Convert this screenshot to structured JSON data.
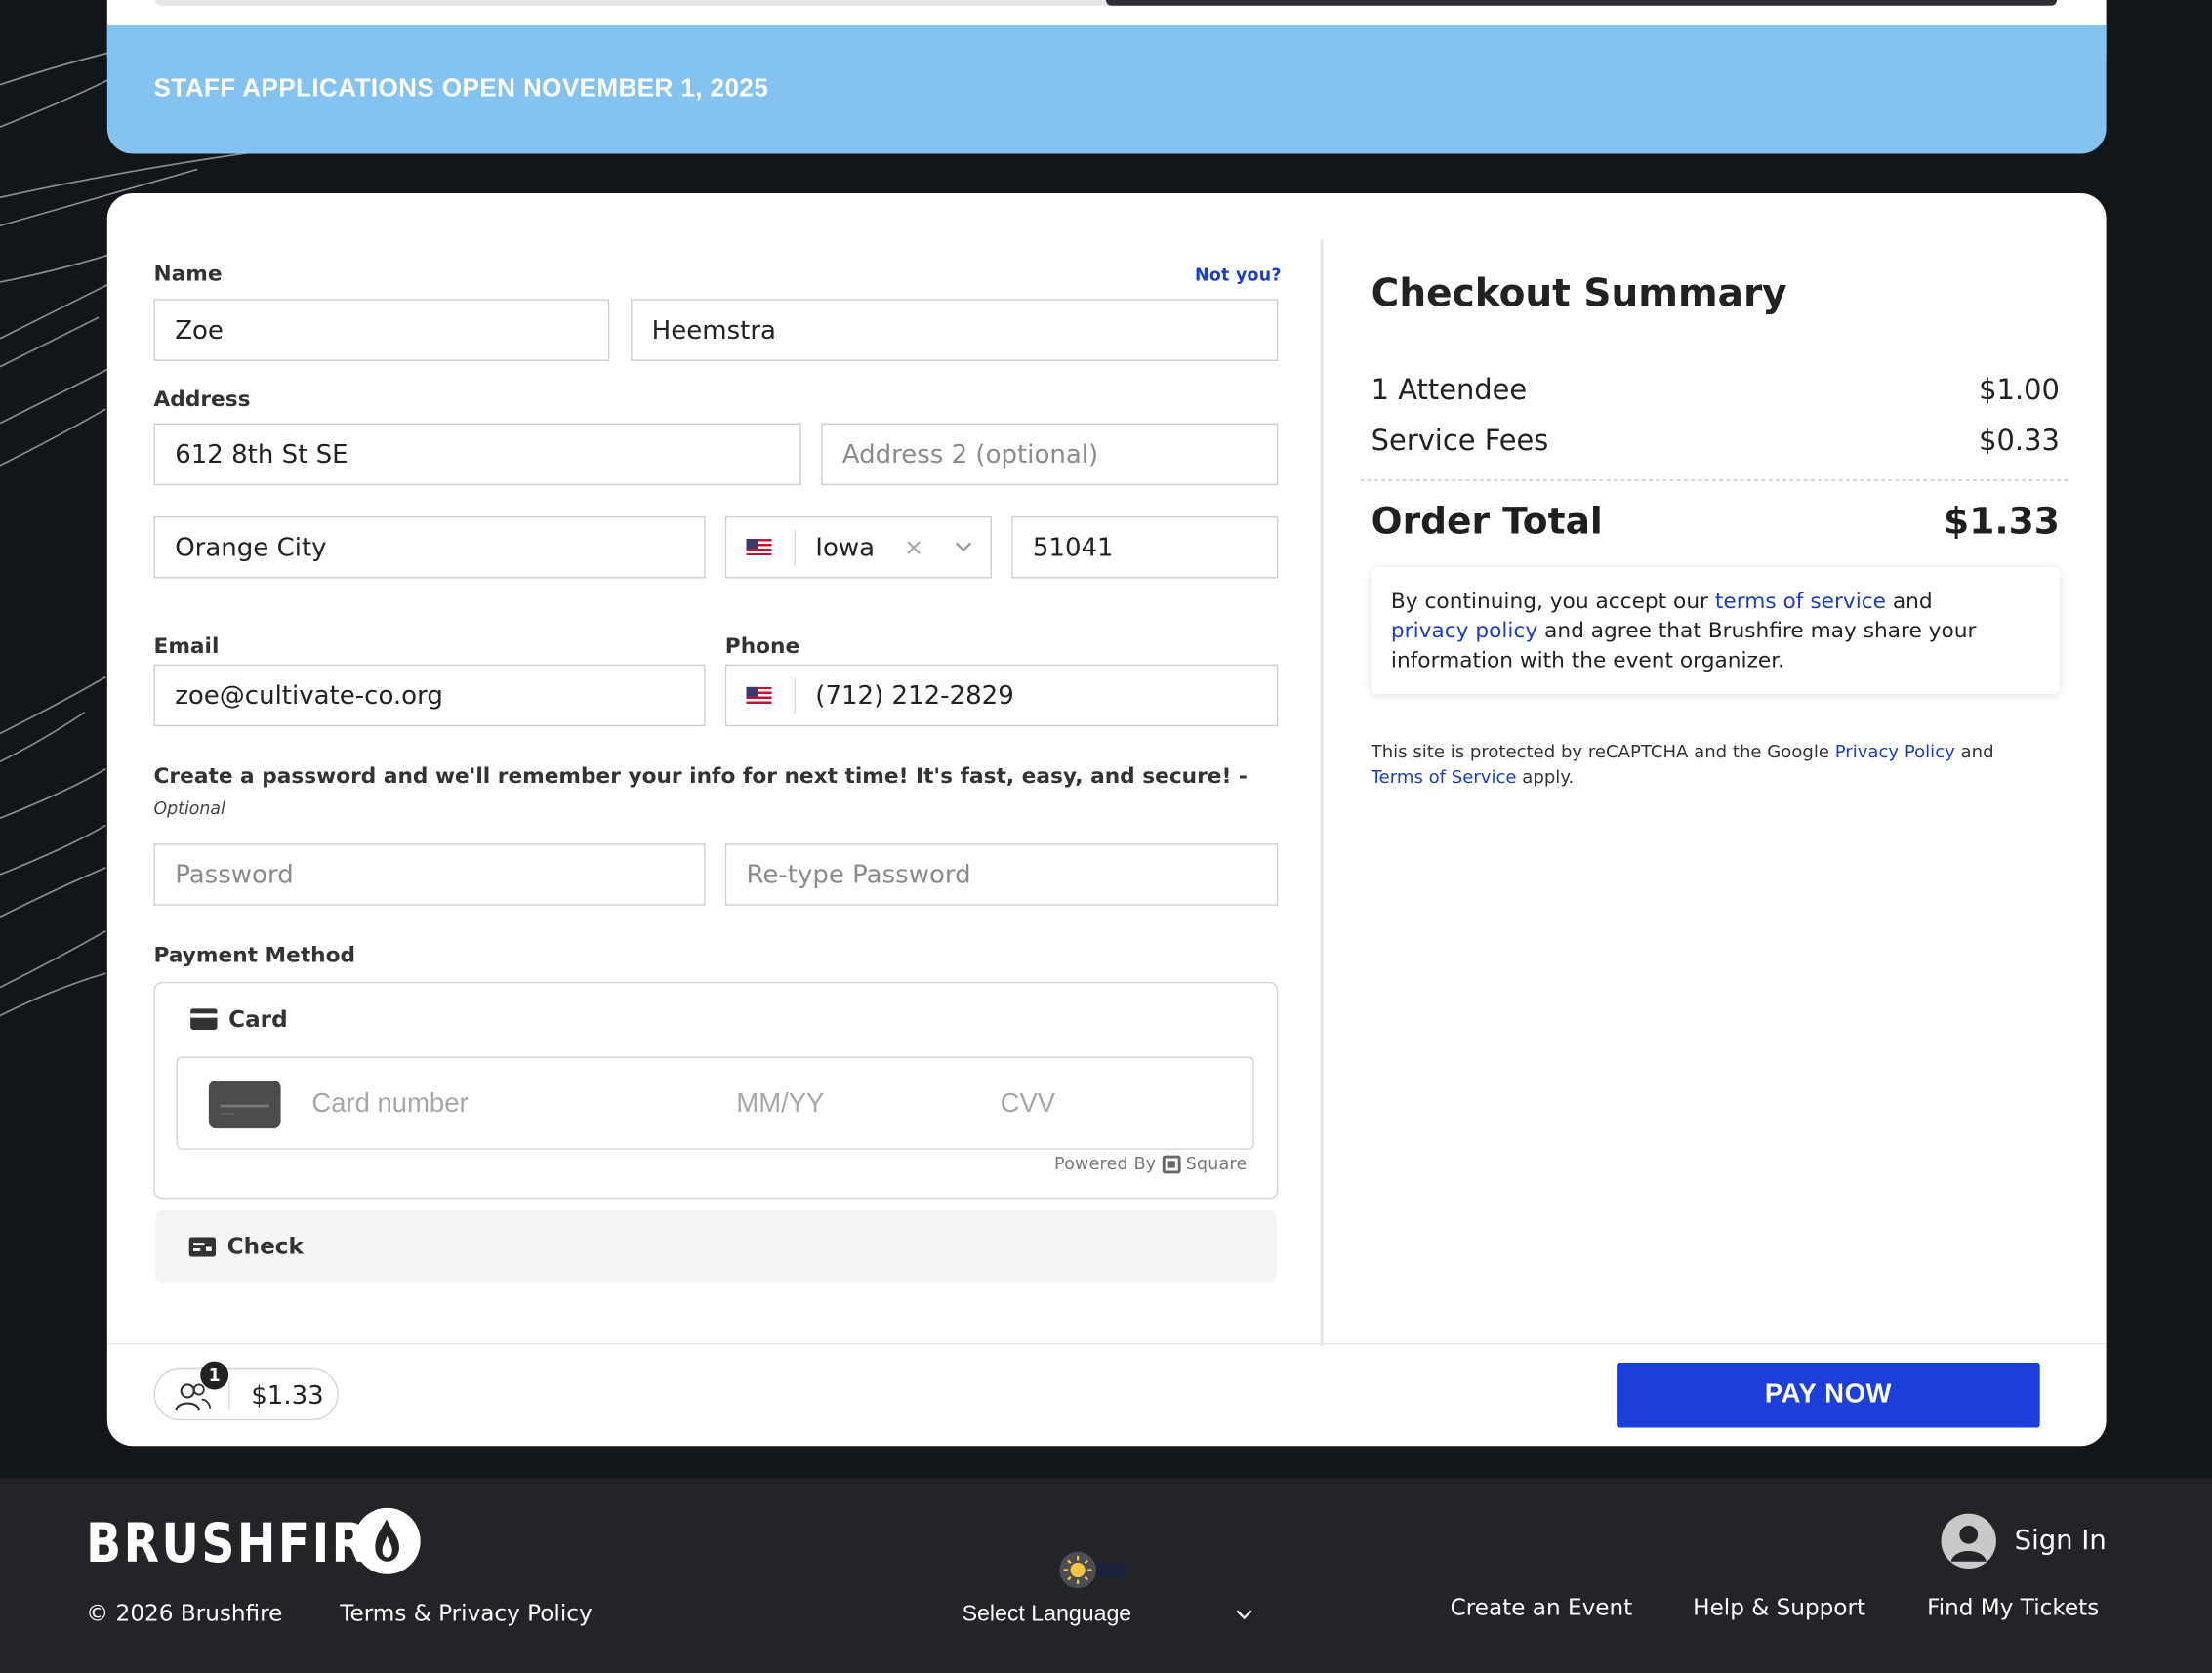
{
  "banner": {
    "text": "STAFF APPLICATIONS OPEN NOVEMBER 1, 2025"
  },
  "form": {
    "name_label": "Name",
    "not_you": "Not you?",
    "first_name": "Zoe",
    "last_name": "Heemstra",
    "address_label": "Address",
    "address1": "612 8th St SE",
    "address2_placeholder": "Address 2 (optional)",
    "city": "Orange City",
    "state": "Iowa",
    "zip": "51041",
    "email_label": "Email",
    "email": "zoe@cultivate-co.org",
    "phone_label": "Phone",
    "phone": "(712) 212-2829",
    "password_hint": "Create a password and we'll remember your info for next time! It's fast, easy, and secure! -",
    "password_optional": "Optional",
    "password_placeholder": "Password",
    "retype_placeholder": "Re-type Password"
  },
  "payment": {
    "label": "Payment Method",
    "card_title": "Card",
    "card_number_placeholder": "Card number",
    "expiry_placeholder": "MM/YY",
    "cvv_placeholder": "CVV",
    "powered_by": "Powered By",
    "provider": "Square",
    "check_title": "Check"
  },
  "summary": {
    "title": "Checkout Summary",
    "items": [
      {
        "label": "1 Attendee",
        "amount": "$1.00"
      },
      {
        "label": "Service Fees",
        "amount": "$0.33"
      }
    ],
    "total_label": "Order Total",
    "total_amount": "$1.33",
    "consent_1": "By continuing, you accept our ",
    "terms_link": "terms of service",
    "consent_2": " and",
    "privacy_link": "privacy policy",
    "consent_3": " and agree that Brushfire may share your information with the event organizer.",
    "recaptcha_1": "This site is protected by reCAPTCHA and the Google ",
    "recaptcha_privacy": "Privacy Policy",
    "recaptcha_2": " and",
    "recaptcha_terms": "Terms of Service",
    "recaptcha_3": " apply."
  },
  "bottom_bar": {
    "attendee_count": "1",
    "amount": "$1.33",
    "pay_label": "PAY NOW"
  },
  "footer": {
    "brand": "BRUSHFIRE",
    "copyright": "© 2026 Brushfire",
    "terms": "Terms & Privacy Policy",
    "language": "Select Language",
    "sign_in": "Sign In",
    "nav": [
      "Create an Event",
      "Help & Support",
      "Find My Tickets"
    ]
  },
  "colors": {
    "banner": "#84c2f0",
    "accent": "#1b3fd8",
    "link": "#1a3cc9",
    "page_bg": "#12161b",
    "footer_bg": "#222427"
  },
  "icons": [
    "us-flag-icon",
    "clear-icon",
    "chevron-down-icon",
    "card-icon",
    "check-icon",
    "square-logo-icon",
    "attendees-icon",
    "flame-logo-icon",
    "sun-icon",
    "user-avatar-icon"
  ]
}
